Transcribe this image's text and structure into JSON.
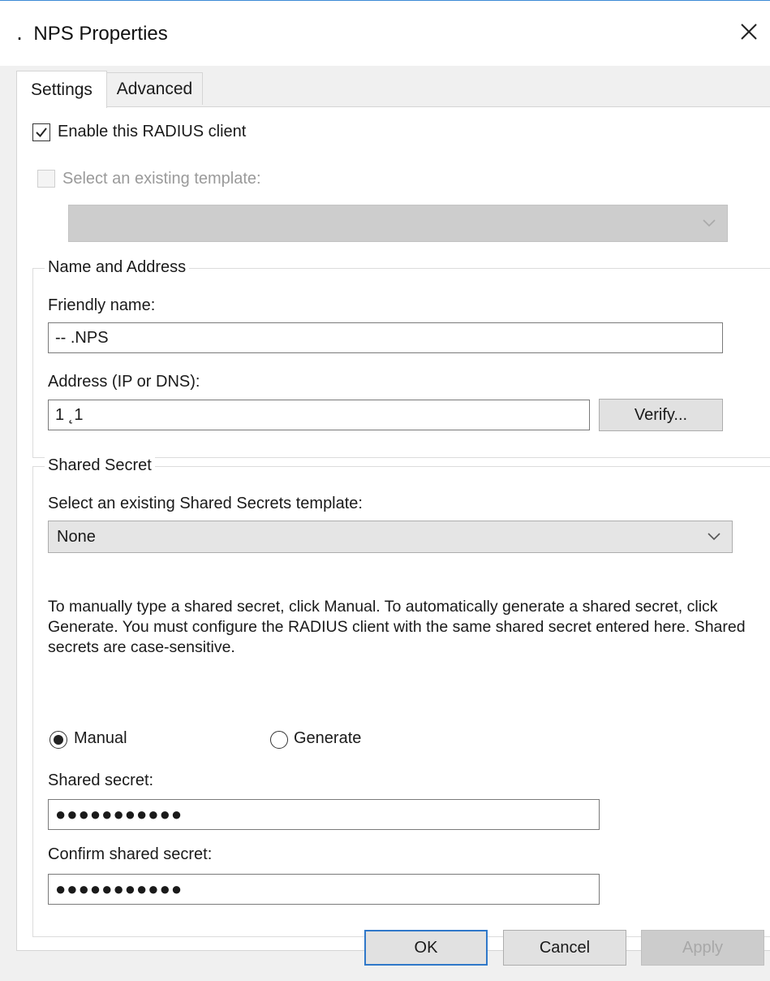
{
  "window": {
    "title": "․   NPS Properties",
    "close_glyph": "✕"
  },
  "tabs": [
    {
      "label": "Settings",
      "selected": true
    },
    {
      "label": "Advanced",
      "selected": false
    }
  ],
  "settings": {
    "enable_client": {
      "label": "Enable this RADIUS client",
      "checked": true
    },
    "existing_template": {
      "label": "Select an existing template:",
      "checked": false,
      "enabled": false
    },
    "template_combo": {
      "value": "",
      "enabled": false
    },
    "name_address": {
      "group_title": "Name and Address",
      "friendly_label": "Friendly name:",
      "friendly_value": "‐‐  .NPS",
      "address_label": "Address (IP or DNS):",
      "address_value": "1            ˛1",
      "verify_label": "Verify..."
    },
    "shared_secret": {
      "group_title": "Shared Secret",
      "template_label": "Select an existing Shared Secrets template:",
      "template_value": "None",
      "description": "To manually type a shared secret, click Manual. To automatically generate a shared secret, click Generate. You must configure the RADIUS client with the same shared secret entered here. Shared secrets are case-sensitive.",
      "radio_manual": "Manual",
      "radio_generate": "Generate",
      "selected_mode": "Manual",
      "secret_label": "Shared secret:",
      "secret_value": "●●●●●●●●●●●",
      "confirm_label": "Confirm shared secret:",
      "confirm_value": "●●●●●●●●●●●"
    }
  },
  "buttons": {
    "ok": "OK",
    "cancel": "Cancel",
    "apply": "Apply"
  },
  "colors": {
    "accent": "#2f78c9",
    "disabled_text": "#9a9a9a"
  },
  "icons": {
    "close": "close-icon",
    "check": "checkmark-icon",
    "dropdown": "chevron-down-icon"
  }
}
